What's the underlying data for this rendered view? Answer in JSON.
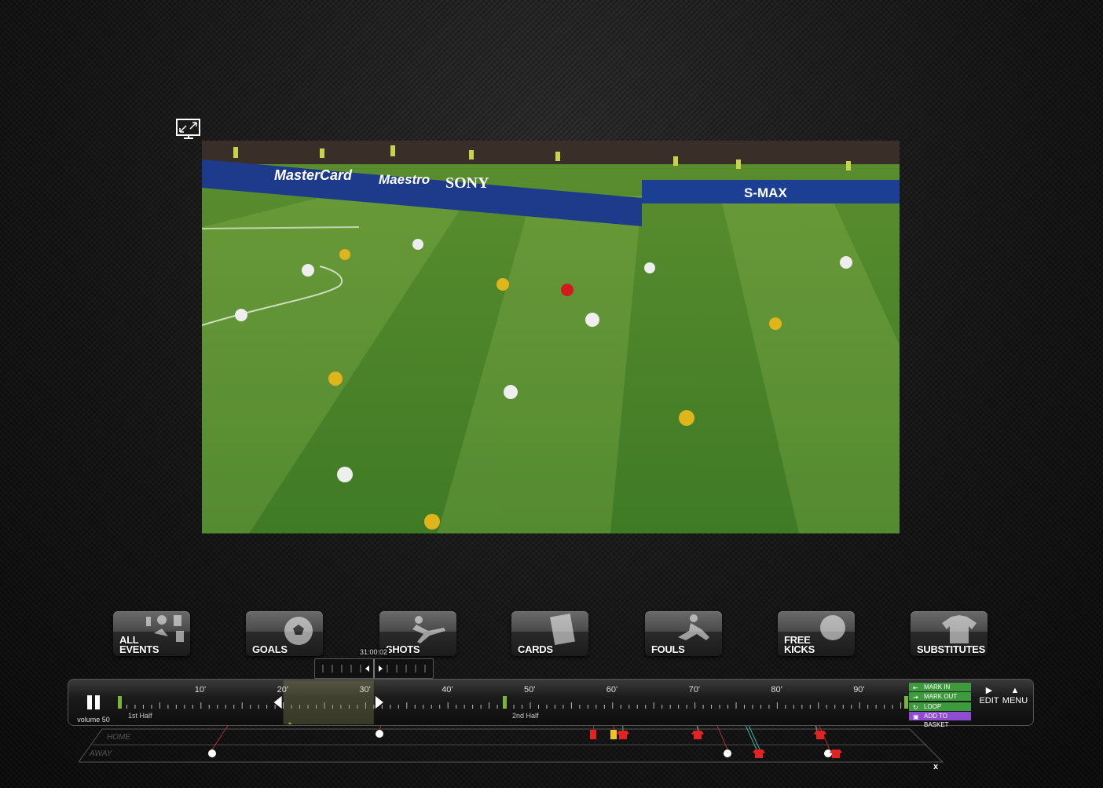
{
  "fullscreen": {
    "icon": "fullscreen-icon"
  },
  "categories": [
    {
      "id": "all-events",
      "label": "ALL\nEVENTS",
      "icon": "all-events-icon"
    },
    {
      "id": "goals",
      "label": "GOALS",
      "icon": "ball-icon"
    },
    {
      "id": "shots",
      "label": "SHOTS",
      "icon": "kicker-icon"
    },
    {
      "id": "cards",
      "label": "CARDS",
      "icon": "card-icon"
    },
    {
      "id": "fouls",
      "label": "FOULS",
      "icon": "tackle-icon"
    },
    {
      "id": "free-kicks",
      "label": "FREE\nKICKS",
      "icon": "free-kick-icon"
    },
    {
      "id": "substitutes",
      "label": "SUBSTITUTES",
      "icon": "shirt-icon"
    }
  ],
  "scrubber": {
    "time": "31:00:02"
  },
  "player": {
    "volume_label": "volume 50",
    "state": "playing"
  },
  "timeline": {
    "ticks": [
      "10'",
      "20'",
      "30'",
      "40'",
      "50'",
      "60'",
      "70'",
      "80'",
      "90'"
    ],
    "first_half_label": "1st Half",
    "second_half_label": "2nd Half",
    "selection_start_min": 20,
    "selection_end_min": 31
  },
  "actions": {
    "mark_in": "MARK IN",
    "mark_out": "MARK OUT",
    "loop": "LOOP",
    "add_to_basket": "ADD TO BASKET",
    "edit": "EDIT",
    "menu": "MENU"
  },
  "tracks": {
    "home": "HOME",
    "away": "AWAY"
  },
  "close": "x"
}
